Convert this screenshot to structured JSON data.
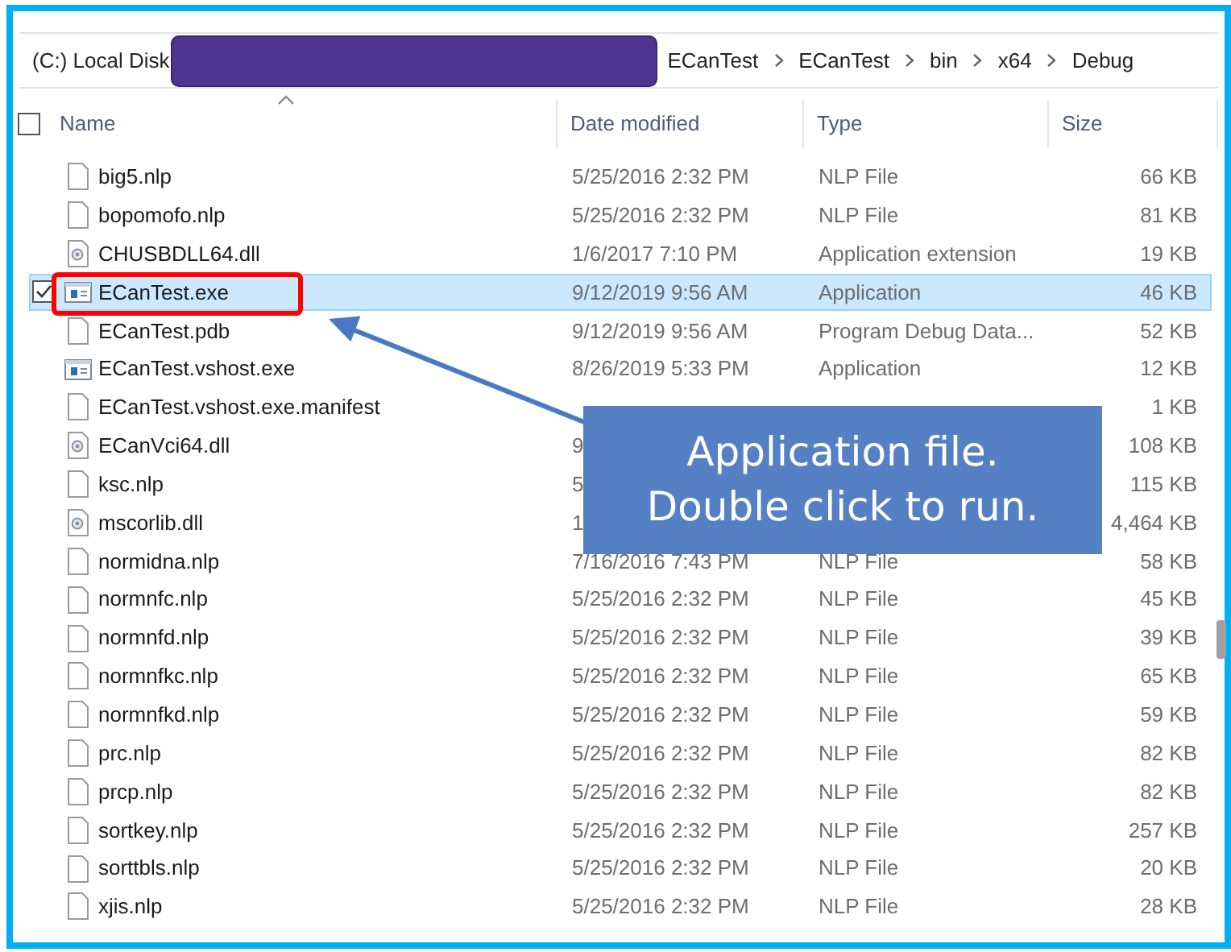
{
  "address_bar": {
    "root": "(C:) Local Disk",
    "segments": [
      "ECanTest",
      "ECanTest",
      "bin",
      "x64",
      "Debug"
    ]
  },
  "table": {
    "columns": [
      "Name",
      "Date modified",
      "Type",
      "Size"
    ],
    "all_checked": false,
    "rows": [
      {
        "kind": "file",
        "name": "big5.nlp",
        "date": "5/25/2016 2:32 PM",
        "type": "NLP File",
        "size": "66 KB",
        "selected": false
      },
      {
        "kind": "file",
        "name": "bopomofo.nlp",
        "date": "5/25/2016 2:32 PM",
        "type": "NLP File",
        "size": "81 KB",
        "selected": false
      },
      {
        "kind": "dll",
        "name": "CHUSBDLL64.dll",
        "date": "1/6/2017 7:10 PM",
        "type": "Application extension",
        "size": "19 KB",
        "selected": false
      },
      {
        "kind": "exe",
        "name": "ECanTest.exe",
        "date": "9/12/2019 9:56 AM",
        "type": "Application",
        "size": "46 KB",
        "selected": true
      },
      {
        "kind": "file",
        "name": "ECanTest.pdb",
        "date": "9/12/2019 9:56 AM",
        "type": "Program Debug Data...",
        "size": "52 KB",
        "selected": false
      },
      {
        "kind": "exe",
        "name": "ECanTest.vshost.exe",
        "date": "8/26/2019 5:33 PM",
        "type": "Application",
        "size": "12 KB",
        "selected": false
      },
      {
        "kind": "file",
        "name": "ECanTest.vshost.exe.manifest",
        "size": "1 KB",
        "selected": false
      },
      {
        "kind": "dll",
        "name": "ECanVci64.dll",
        "date": "9",
        "size": "108 KB",
        "selected": false
      },
      {
        "kind": "file",
        "name": "ksc.nlp",
        "date": "5",
        "size": "115 KB",
        "selected": false
      },
      {
        "kind": "dll",
        "name": "mscorlib.dll",
        "date": "1",
        "size": "4,464 KB",
        "selected": false
      },
      {
        "kind": "file",
        "name": "normidna.nlp",
        "date": "7/16/2016 7:43 PM",
        "type": "NLP File",
        "size": "58 KB",
        "selected": false
      },
      {
        "kind": "file",
        "name": "normnfc.nlp",
        "date": "5/25/2016 2:32 PM",
        "type": "NLP File",
        "size": "45 KB",
        "selected": false
      },
      {
        "kind": "file",
        "name": "normnfd.nlp",
        "date": "5/25/2016 2:32 PM",
        "type": "NLP File",
        "size": "39 KB",
        "selected": false
      },
      {
        "kind": "file",
        "name": "normnfkc.nlp",
        "date": "5/25/2016 2:32 PM",
        "type": "NLP File",
        "size": "65 KB",
        "selected": false
      },
      {
        "kind": "file",
        "name": "normnfkd.nlp",
        "date": "5/25/2016 2:32 PM",
        "type": "NLP File",
        "size": "59 KB",
        "selected": false
      },
      {
        "kind": "file",
        "name": "prc.nlp",
        "date": "5/25/2016 2:32 PM",
        "type": "NLP File",
        "size": "82 KB",
        "selected": false
      },
      {
        "kind": "file",
        "name": "prcp.nlp",
        "date": "5/25/2016 2:32 PM",
        "type": "NLP File",
        "size": "82 KB",
        "selected": false
      },
      {
        "kind": "file",
        "name": "sortkey.nlp",
        "date": "5/25/2016 2:32 PM",
        "type": "NLP File",
        "size": "257 KB",
        "selected": false
      },
      {
        "kind": "file",
        "name": "sorttbls.nlp",
        "date": "5/25/2016 2:32 PM",
        "type": "NLP File",
        "size": "20 KB",
        "selected": false
      },
      {
        "kind": "file",
        "name": "xjis.nlp",
        "date": "5/25/2016 2:32 PM",
        "type": "NLP File",
        "size": "28 KB",
        "selected": false
      }
    ]
  },
  "callout": {
    "lines": [
      "Application file.",
      "Double click to run."
    ]
  }
}
